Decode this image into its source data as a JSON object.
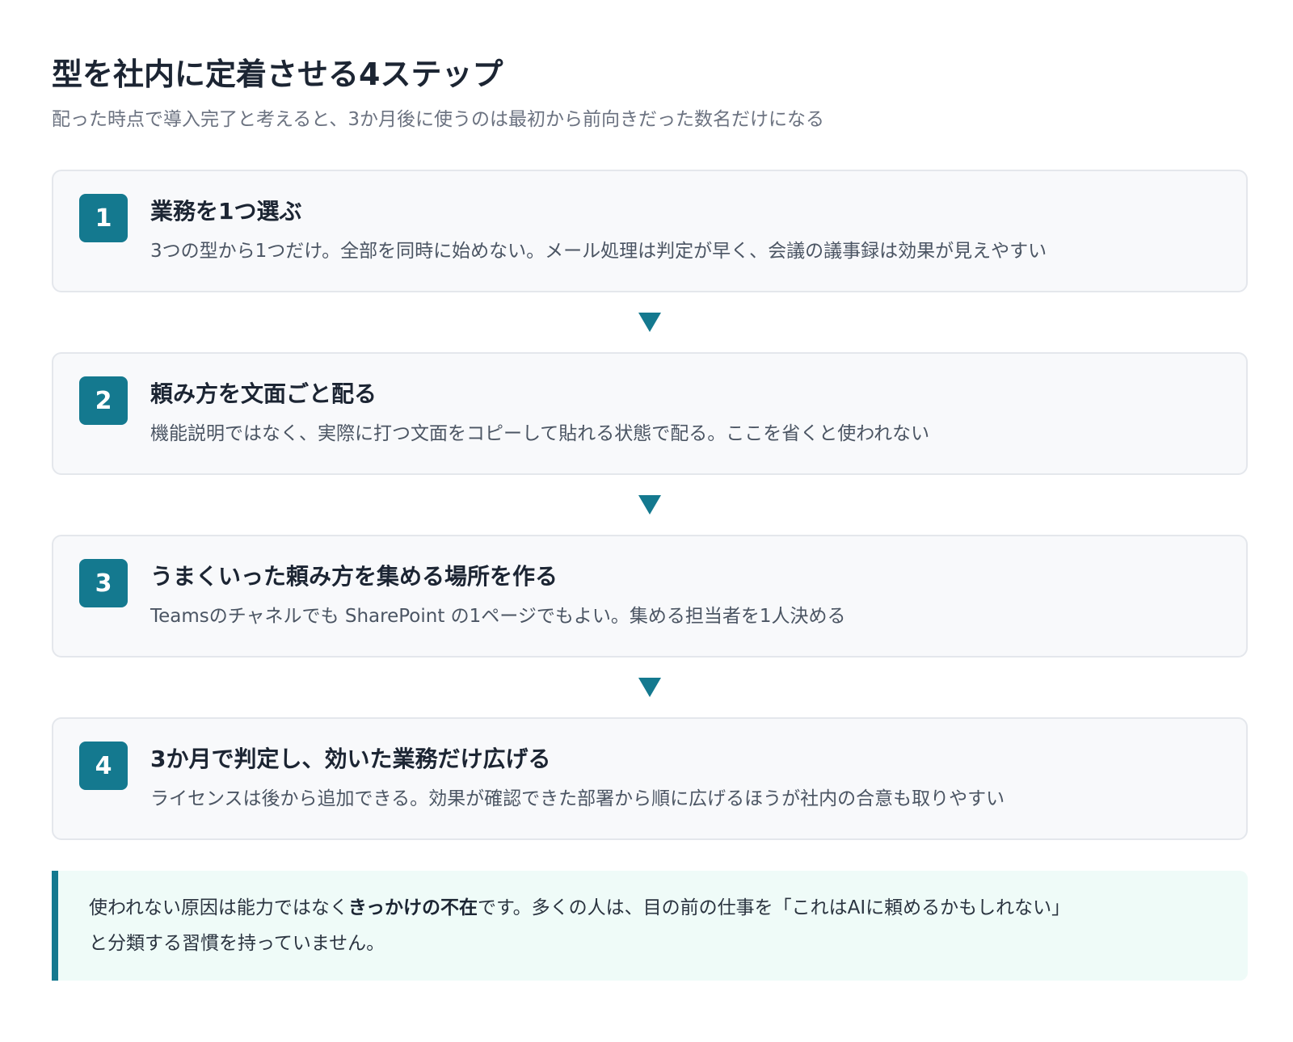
{
  "title": "型を社内に定着させる4ステップ",
  "subtitle": "配った時点で導入完了と考えると、3か月後に使うのは最初から前向きだった数名だけになる",
  "steps": [
    {
      "number": "1",
      "title": "業務を1つ選ぶ",
      "description": "3つの型から1つだけ。全部を同時に始めない。メール処理は判定が早く、会議の議事録は効果が見えやすい"
    },
    {
      "number": "2",
      "title": "頼み方を文面ごと配る",
      "description": "機能説明ではなく、実際に打つ文面をコピーして貼れる状態で配る。ここを省くと使われない"
    },
    {
      "number": "3",
      "title": "うまくいった頼み方を集める場所を作る",
      "description": "Teamsのチャネルでも SharePoint の1ページでもよい。集める担当者を1人決める"
    },
    {
      "number": "4",
      "title": "3か月で判定し、効いた業務だけ広げる",
      "description": "ライセンスは後から追加できる。効果が確認できた部署から順に広げるほうが社内の合意も取りやすい"
    }
  ],
  "arrow_icon": "triangle-down-icon",
  "note": {
    "text_before": "使われない原因は能力ではなく",
    "emphasis": "きっかけの不在",
    "text_after": "です。多くの人は、目の前の仕事を「これはAIに頼めるかもしれない」",
    "line2": "と分類する習慣を持っていません。"
  },
  "colors": {
    "accent": "#14798f",
    "card_background": "#f8f9fb",
    "card_border": "#e4e7ec",
    "note_background": "#effbf8"
  }
}
